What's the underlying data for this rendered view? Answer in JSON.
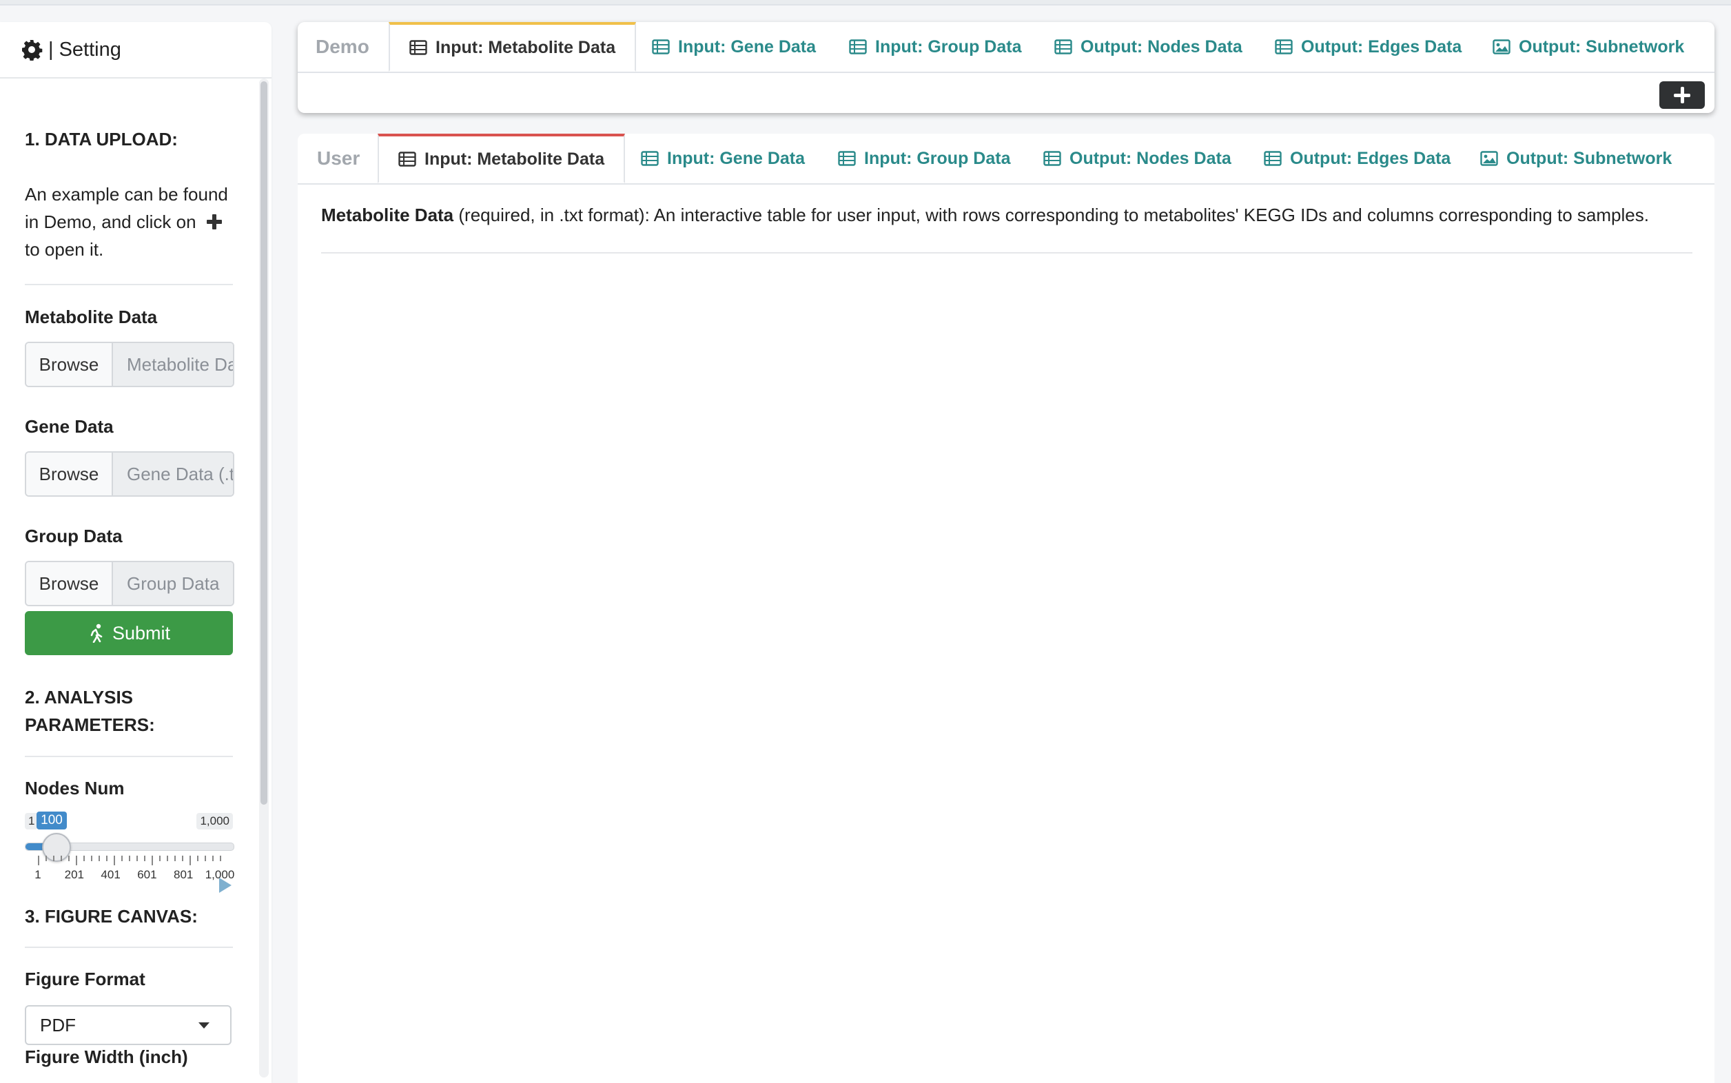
{
  "sidebar": {
    "title": "| Setting",
    "section1": "1. DATA UPLOAD:",
    "hint": "An example can be found in Demo, and click on",
    "hint_tail": "to open it.",
    "metabolite_label": "Metabolite Data",
    "metabolite_browse": "Browse",
    "metabolite_placeholder": "Metabolite Data (.txt)",
    "gene_label": "Gene Data",
    "gene_browse": "Browse",
    "gene_placeholder": "Gene Data (.txt)",
    "group_label": "Group Data",
    "group_browse": "Browse",
    "group_placeholder": "Group Data",
    "submit_label": "Submit",
    "section2": "2. ANALYSIS PARAMETERS:",
    "nodes_label": "Nodes Num",
    "slider": {
      "min": 1,
      "max": 1000,
      "value": 100,
      "min_label": "1",
      "max_label": "1,000",
      "value_label": "100",
      "tick_labels": [
        "1",
        "201",
        "401",
        "601",
        "801",
        "1,000"
      ]
    },
    "section3": "3. FIGURE CANVAS:",
    "figure_format_label": "Figure Format",
    "figure_format_value": "PDF",
    "figure_width_label": "Figure Width (inch)"
  },
  "demo_tabs": {
    "label": "Demo",
    "tabs": [
      "Input: Metabolite Data",
      "Input: Gene Data",
      "Input: Group Data",
      "Output: Nodes Data",
      "Output: Edges Data",
      "Output: Subnetwork"
    ],
    "active": "Input: Metabolite Data"
  },
  "user_tabs": {
    "label": "User",
    "tabs": [
      "Input: Metabolite Data",
      "Input: Gene Data",
      "Input: Group Data",
      "Output: Nodes Data",
      "Output: Edges Data",
      "Output: Subnetwork"
    ],
    "active": "Input: Metabolite Data",
    "description_bold": "Metabolite Data",
    "description_rest": " (required, in .txt format): An interactive table for user input, with rows corresponding to metabolites' KEGG IDs and columns corresponding to samples."
  },
  "colors": {
    "accent_teal": "#2a8a8a",
    "submit_green": "#3c9a46",
    "slider_blue": "#428bca",
    "demo_active_border": "#f0c04a",
    "user_active_border": "#d9534f"
  }
}
